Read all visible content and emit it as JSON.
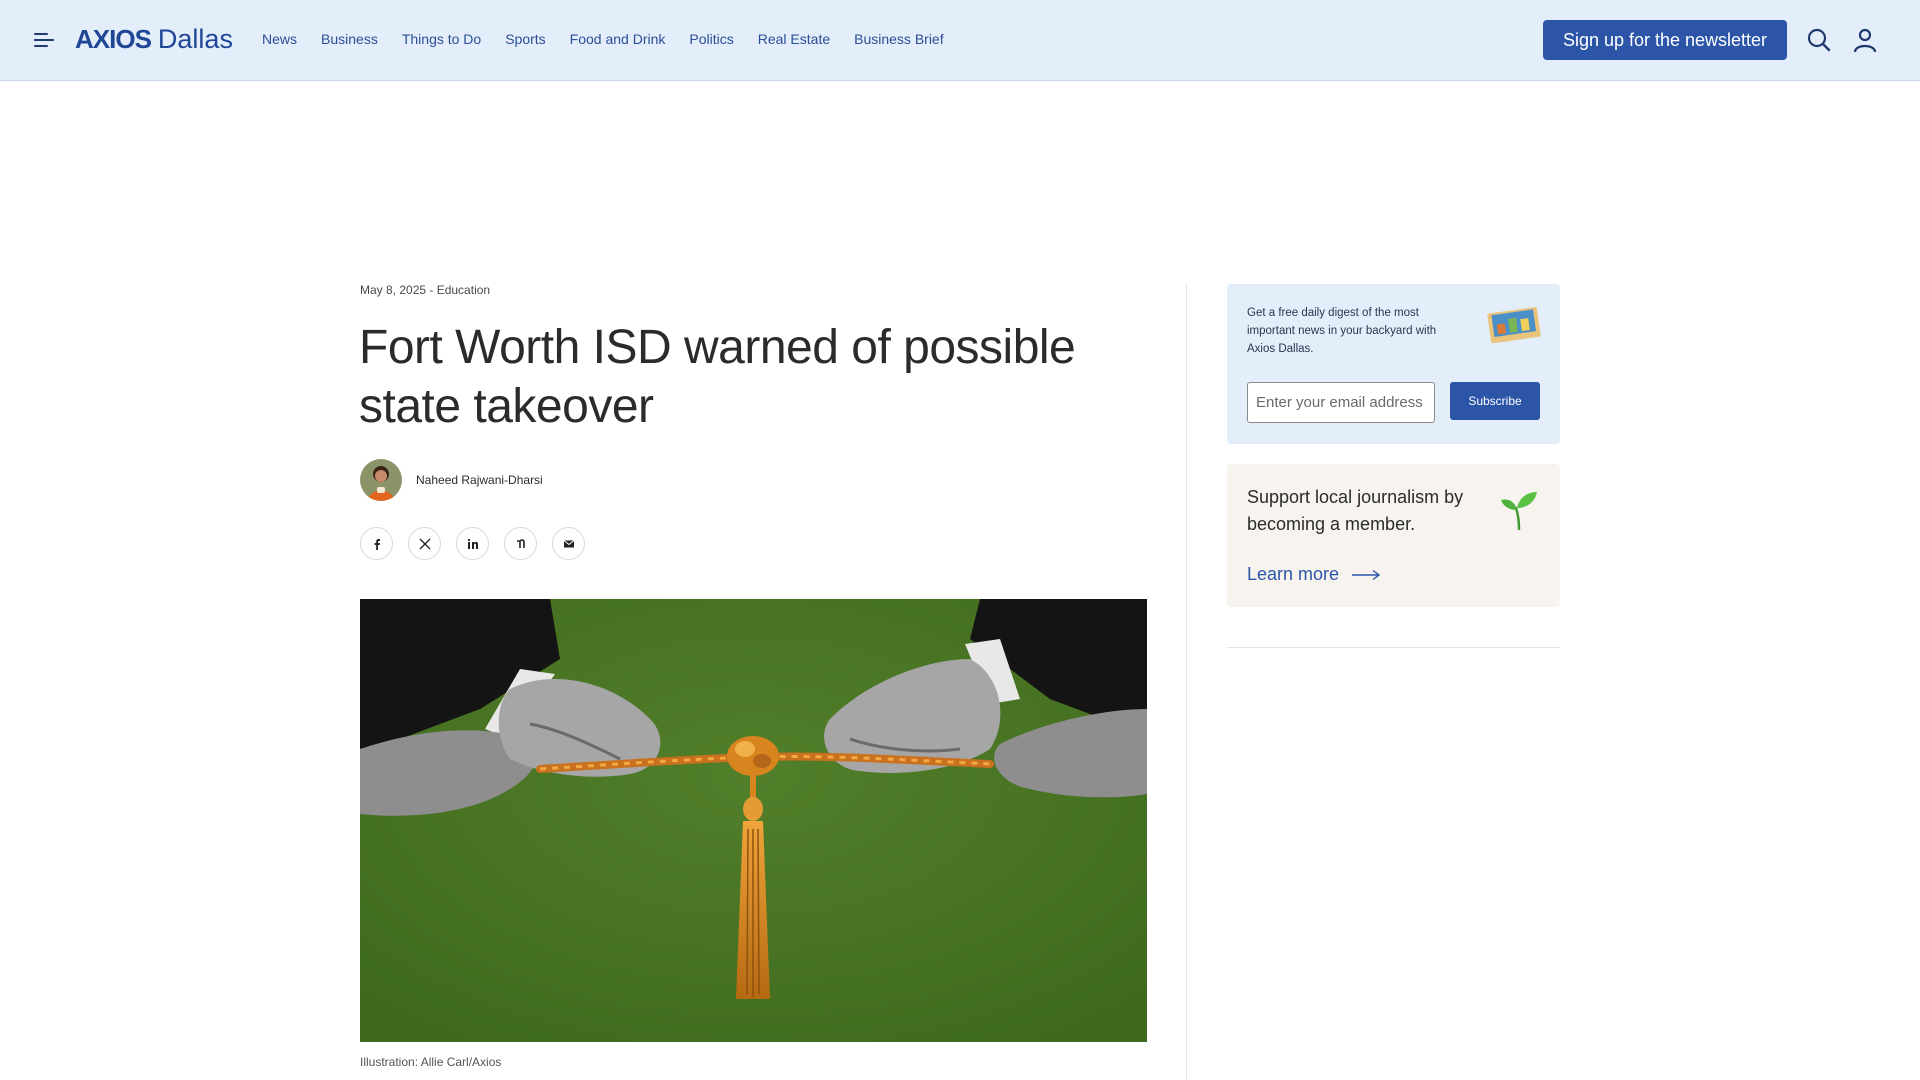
{
  "header": {
    "logo_brand": "AXIOS",
    "logo_city": "Dallas",
    "nav": [
      "News",
      "Business",
      "Things to Do",
      "Sports",
      "Food and Drink",
      "Politics",
      "Real Estate",
      "Business Brief"
    ],
    "signup_label": "Sign up for the newsletter",
    "icons": [
      "menu-icon",
      "search-icon",
      "user-icon"
    ]
  },
  "article": {
    "meta": "May 8, 2025 - Education",
    "title": "Fort Worth ISD warned of possible state takeover",
    "author": "Naheed Rajwani-Dharsi",
    "share_icons": [
      "facebook-icon",
      "x-icon",
      "linkedin-icon",
      "threads-icon",
      "email-icon"
    ],
    "caption": "Illustration: Allie Carl/Axios"
  },
  "sidebar": {
    "newsletter": {
      "description": "Get a free daily digest of the most important news in your backyard with Axios Dallas.",
      "email_placeholder": "Enter your email address",
      "subscribe_label": "Subscribe"
    },
    "membership": {
      "lead": "Support local journalism by becoming a member.",
      "cta": "Learn more"
    }
  },
  "colors": {
    "header_bg": "#e4eefa",
    "brand_blue": "#2c55a8",
    "hero_green": "#4a7a25",
    "member_card_bg": "#f7f4ef"
  }
}
